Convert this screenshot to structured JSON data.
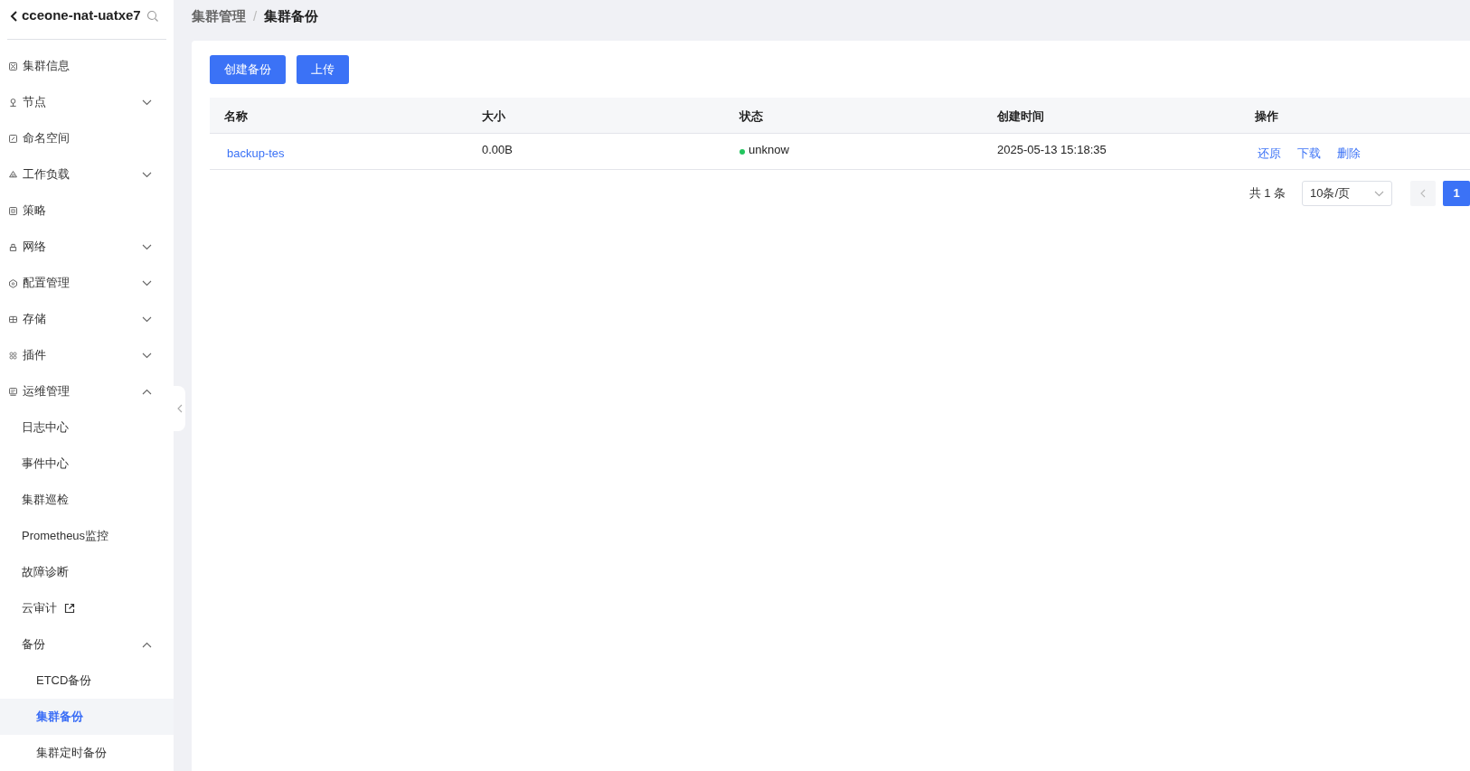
{
  "sidebar": {
    "title": "cceone-nat-uatxe7",
    "items": [
      {
        "label": "集群信息",
        "selected": false
      },
      {
        "label": "节点",
        "selected": false,
        "expanded": false
      },
      {
        "label": "命名空间",
        "selected": false
      },
      {
        "label": "工作负载",
        "selected": false,
        "expanded": false
      },
      {
        "label": "策略",
        "selected": false
      },
      {
        "label": "网络",
        "selected": false,
        "expanded": false
      },
      {
        "label": "配置管理",
        "selected": false,
        "expanded": false
      },
      {
        "label": "存储",
        "selected": false,
        "expanded": false
      },
      {
        "label": "插件",
        "selected": false,
        "expanded": false
      },
      {
        "label": "运维管理",
        "selected": false,
        "expanded": true,
        "children": [
          {
            "label": "日志中心",
            "selected": false
          },
          {
            "label": "事件中心",
            "selected": false
          },
          {
            "label": "集群巡检",
            "selected": false
          },
          {
            "label": "Prometheus监控",
            "selected": false
          },
          {
            "label": "故障诊断",
            "selected": false
          },
          {
            "label": "云审计",
            "selected": false,
            "external": true
          },
          {
            "label": "备份",
            "selected": false,
            "expanded": true,
            "children": [
              {
                "label": "ETCD备份",
                "selected": false
              },
              {
                "label": "集群备份",
                "selected": true
              },
              {
                "label": "集群定时备份",
                "selected": false
              }
            ]
          }
        ]
      }
    ]
  },
  "breadcrumb": {
    "items": [
      "集群管理",
      "集群备份"
    ],
    "separator": "/"
  },
  "buttons": [
    "创建备份",
    "上传"
  ],
  "table": {
    "columns": [
      "名称",
      "大小",
      "状态",
      "创建时间",
      "操作"
    ],
    "rows": [
      {
        "name": "backup-tes",
        "size": "0.00B",
        "status": "unknow",
        "color": "#22c55e",
        "created": "2025-05-13 15:18:35",
        "actions": [
          "还原",
          "下载",
          "删除"
        ]
      }
    ]
  },
  "pagination": {
    "total": "共 1 条",
    "page_size": "10条/页",
    "pages": [
      {
        "label": "1",
        "selected": true
      }
    ]
  }
}
